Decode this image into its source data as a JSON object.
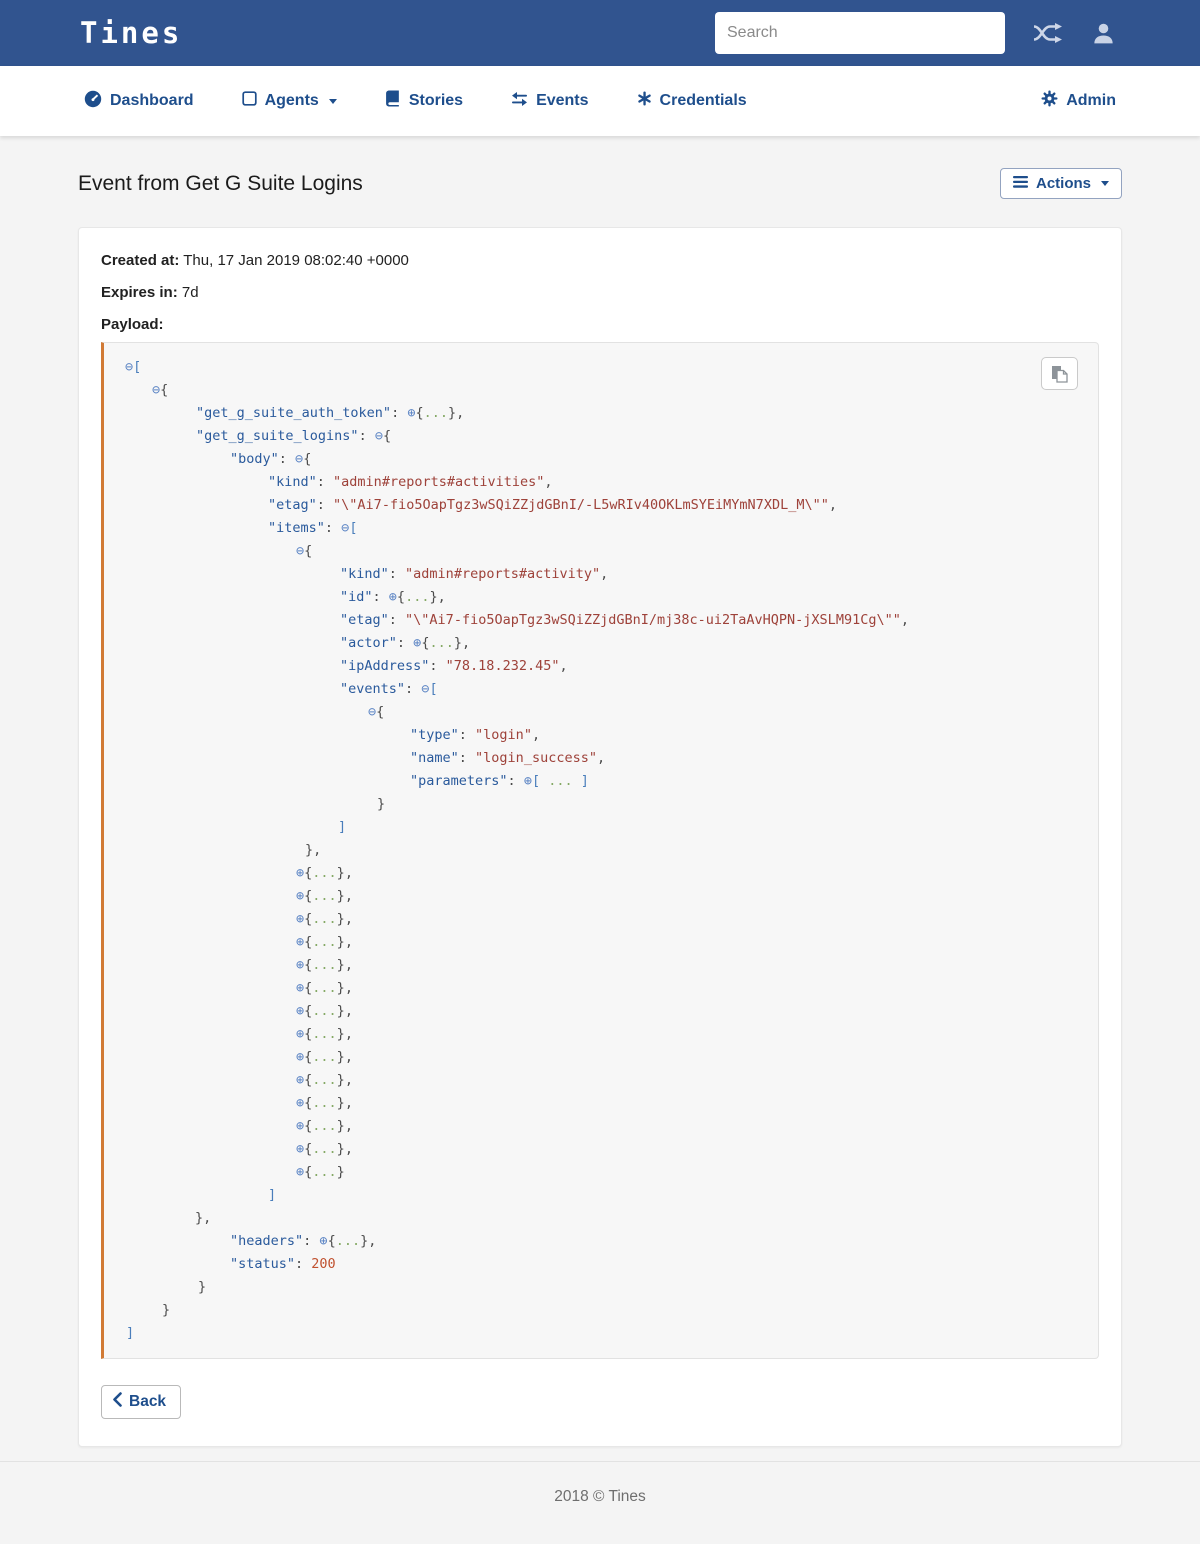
{
  "navbar": {
    "logo": "Tines",
    "search_placeholder": "Search",
    "shuffle_icon": "shuffle-icon",
    "user_icon": "user-icon"
  },
  "nav": {
    "items": [
      {
        "label": "Dashboard",
        "icon": "dashboard-gauge-icon"
      },
      {
        "label": "Agents",
        "icon": "agents-square-icon",
        "has_caret": true
      },
      {
        "label": "Stories",
        "icon": "stories-book-icon"
      },
      {
        "label": "Events",
        "icon": "events-exchange-icon"
      },
      {
        "label": "Credentials",
        "icon": "credentials-asterisk-icon"
      }
    ],
    "admin": {
      "label": "Admin",
      "icon": "admin-gear-icon"
    }
  },
  "page": {
    "title": "Event from Get G Suite Logins",
    "actions_label": "Actions"
  },
  "event": {
    "created_at_label": "Created at:",
    "created_at_value": "Thu, 17 Jan 2019 08:02:40 +0000",
    "expires_label": "Expires in:",
    "expires_value": "7d",
    "payload_label": "Payload:"
  },
  "buttons": {
    "back_label": "Back",
    "copy_icon": "copy-icon"
  },
  "footer": {
    "text": "2018 © Tines"
  },
  "colors": {
    "navbar_blue": "#31548f",
    "nav_link_blue": "#1e4e8c",
    "payload_accent_orange": "#d17a35",
    "json_key": "#2a5a9c",
    "json_string": "#9e423a",
    "json_number": "#c0512f",
    "json_disclosure": "#5b84c4",
    "json_ellipsis": "#85a965"
  },
  "payload": {
    "lines": [
      {
        "i": 0,
        "s": [
          [
            "d",
            "⊖"
          ],
          [
            "a",
            "["
          ]
        ]
      },
      {
        "i": 27,
        "s": [
          [
            "d",
            "⊖"
          ],
          [
            "o",
            "{"
          ]
        ]
      },
      {
        "i": 71,
        "s": [
          [
            "k",
            "\"get_g_suite_auth_token\""
          ],
          [
            "p",
            ": "
          ],
          [
            "d",
            "⊕"
          ],
          [
            "o",
            "{"
          ],
          [
            "e",
            "..."
          ],
          [
            "o",
            "}"
          ],
          [
            "p",
            ","
          ]
        ]
      },
      {
        "i": 71,
        "s": [
          [
            "k",
            "\"get_g_suite_logins\""
          ],
          [
            "p",
            ": "
          ],
          [
            "d",
            "⊖"
          ],
          [
            "o",
            "{"
          ]
        ]
      },
      {
        "i": 105,
        "s": [
          [
            "k",
            "\"body\""
          ],
          [
            "p",
            ": "
          ],
          [
            "d",
            "⊖"
          ],
          [
            "o",
            "{"
          ]
        ]
      },
      {
        "i": 143,
        "s": [
          [
            "k",
            "\"kind\""
          ],
          [
            "p",
            ": "
          ],
          [
            "s",
            "\"admin#reports#activities\""
          ],
          [
            "p",
            ","
          ]
        ]
      },
      {
        "i": 143,
        "s": [
          [
            "k",
            "\"etag\""
          ],
          [
            "p",
            ": "
          ],
          [
            "s",
            "\"\\\"Ai7-fio5OapTgz3wSQiZZjdGBnI/-L5wRIv40OKLmSYEiMYmN7XDL_M\\\"\""
          ],
          [
            "p",
            ","
          ]
        ]
      },
      {
        "i": 143,
        "s": [
          [
            "k",
            "\"items\""
          ],
          [
            "p",
            ": "
          ],
          [
            "d",
            "⊖"
          ],
          [
            "a",
            "["
          ]
        ]
      },
      {
        "i": 171,
        "s": [
          [
            "d",
            "⊖"
          ],
          [
            "o",
            "{"
          ]
        ]
      },
      {
        "i": 215,
        "s": [
          [
            "k",
            "\"kind\""
          ],
          [
            "p",
            ": "
          ],
          [
            "s",
            "\"admin#reports#activity\""
          ],
          [
            "p",
            ","
          ]
        ]
      },
      {
        "i": 215,
        "s": [
          [
            "k",
            "\"id\""
          ],
          [
            "p",
            ": "
          ],
          [
            "d",
            "⊕"
          ],
          [
            "o",
            "{"
          ],
          [
            "e",
            "..."
          ],
          [
            "o",
            "}"
          ],
          [
            "p",
            ","
          ]
        ]
      },
      {
        "i": 215,
        "s": [
          [
            "k",
            "\"etag\""
          ],
          [
            "p",
            ": "
          ],
          [
            "s",
            "\"\\\"Ai7-fio5OapTgz3wSQiZZjdGBnI/mj38c-ui2TaAvHQPN-jXSLM91Cg\\\"\""
          ],
          [
            "p",
            ","
          ]
        ]
      },
      {
        "i": 215,
        "s": [
          [
            "k",
            "\"actor\""
          ],
          [
            "p",
            ": "
          ],
          [
            "d",
            "⊕"
          ],
          [
            "o",
            "{"
          ],
          [
            "e",
            "..."
          ],
          [
            "o",
            "}"
          ],
          [
            "p",
            ","
          ]
        ]
      },
      {
        "i": 215,
        "s": [
          [
            "k",
            "\"ipAddress\""
          ],
          [
            "p",
            ": "
          ],
          [
            "s",
            "\"78.18.232.45\""
          ],
          [
            "p",
            ","
          ]
        ]
      },
      {
        "i": 215,
        "s": [
          [
            "k",
            "\"events\""
          ],
          [
            "p",
            ": "
          ],
          [
            "d",
            "⊖"
          ],
          [
            "a",
            "["
          ]
        ]
      },
      {
        "i": 243,
        "s": [
          [
            "d",
            "⊖"
          ],
          [
            "o",
            "{"
          ]
        ]
      },
      {
        "i": 285,
        "s": [
          [
            "k",
            "\"type\""
          ],
          [
            "p",
            ": "
          ],
          [
            "s",
            "\"login\""
          ],
          [
            "p",
            ","
          ]
        ]
      },
      {
        "i": 285,
        "s": [
          [
            "k",
            "\"name\""
          ],
          [
            "p",
            ": "
          ],
          [
            "s",
            "\"login_success\""
          ],
          [
            "p",
            ","
          ]
        ]
      },
      {
        "i": 285,
        "s": [
          [
            "k",
            "\"parameters\""
          ],
          [
            "p",
            ": "
          ],
          [
            "d",
            "⊕"
          ],
          [
            "a",
            "["
          ],
          [
            "e",
            " ... "
          ],
          [
            "a",
            "]"
          ]
        ]
      },
      {
        "i": 252,
        "s": [
          [
            "o",
            "}"
          ]
        ]
      },
      {
        "i": 213,
        "s": [
          [
            "a",
            "]"
          ]
        ]
      },
      {
        "i": 180,
        "s": [
          [
            "o",
            "}"
          ],
          [
            "p",
            ","
          ]
        ]
      },
      {
        "i": 171,
        "s": [
          [
            "d",
            "⊕"
          ],
          [
            "o",
            "{"
          ],
          [
            "e",
            "..."
          ],
          [
            "o",
            "}"
          ],
          [
            "p",
            ","
          ]
        ]
      },
      {
        "i": 171,
        "s": [
          [
            "d",
            "⊕"
          ],
          [
            "o",
            "{"
          ],
          [
            "e",
            "..."
          ],
          [
            "o",
            "}"
          ],
          [
            "p",
            ","
          ]
        ]
      },
      {
        "i": 171,
        "s": [
          [
            "d",
            "⊕"
          ],
          [
            "o",
            "{"
          ],
          [
            "e",
            "..."
          ],
          [
            "o",
            "}"
          ],
          [
            "p",
            ","
          ]
        ]
      },
      {
        "i": 171,
        "s": [
          [
            "d",
            "⊕"
          ],
          [
            "o",
            "{"
          ],
          [
            "e",
            "..."
          ],
          [
            "o",
            "}"
          ],
          [
            "p",
            ","
          ]
        ]
      },
      {
        "i": 171,
        "s": [
          [
            "d",
            "⊕"
          ],
          [
            "o",
            "{"
          ],
          [
            "e",
            "..."
          ],
          [
            "o",
            "}"
          ],
          [
            "p",
            ","
          ]
        ]
      },
      {
        "i": 171,
        "s": [
          [
            "d",
            "⊕"
          ],
          [
            "o",
            "{"
          ],
          [
            "e",
            "..."
          ],
          [
            "o",
            "}"
          ],
          [
            "p",
            ","
          ]
        ]
      },
      {
        "i": 171,
        "s": [
          [
            "d",
            "⊕"
          ],
          [
            "o",
            "{"
          ],
          [
            "e",
            "..."
          ],
          [
            "o",
            "}"
          ],
          [
            "p",
            ","
          ]
        ]
      },
      {
        "i": 171,
        "s": [
          [
            "d",
            "⊕"
          ],
          [
            "o",
            "{"
          ],
          [
            "e",
            "..."
          ],
          [
            "o",
            "}"
          ],
          [
            "p",
            ","
          ]
        ]
      },
      {
        "i": 171,
        "s": [
          [
            "d",
            "⊕"
          ],
          [
            "o",
            "{"
          ],
          [
            "e",
            "..."
          ],
          [
            "o",
            "}"
          ],
          [
            "p",
            ","
          ]
        ]
      },
      {
        "i": 171,
        "s": [
          [
            "d",
            "⊕"
          ],
          [
            "o",
            "{"
          ],
          [
            "e",
            "..."
          ],
          [
            "o",
            "}"
          ],
          [
            "p",
            ","
          ]
        ]
      },
      {
        "i": 171,
        "s": [
          [
            "d",
            "⊕"
          ],
          [
            "o",
            "{"
          ],
          [
            "e",
            "..."
          ],
          [
            "o",
            "}"
          ],
          [
            "p",
            ","
          ]
        ]
      },
      {
        "i": 171,
        "s": [
          [
            "d",
            "⊕"
          ],
          [
            "o",
            "{"
          ],
          [
            "e",
            "..."
          ],
          [
            "o",
            "}"
          ],
          [
            "p",
            ","
          ]
        ]
      },
      {
        "i": 171,
        "s": [
          [
            "d",
            "⊕"
          ],
          [
            "o",
            "{"
          ],
          [
            "e",
            "..."
          ],
          [
            "o",
            "}"
          ],
          [
            "p",
            ","
          ]
        ]
      },
      {
        "i": 171,
        "s": [
          [
            "d",
            "⊕"
          ],
          [
            "o",
            "{"
          ],
          [
            "e",
            "..."
          ],
          [
            "o",
            "}"
          ]
        ]
      },
      {
        "i": 143,
        "s": [
          [
            "a",
            "]"
          ]
        ]
      },
      {
        "i": 70,
        "s": [
          [
            "o",
            "}"
          ],
          [
            "p",
            ","
          ]
        ]
      },
      {
        "i": 105,
        "s": [
          [
            "k",
            "\"headers\""
          ],
          [
            "p",
            ": "
          ],
          [
            "d",
            "⊕"
          ],
          [
            "o",
            "{"
          ],
          [
            "e",
            "..."
          ],
          [
            "o",
            "}"
          ],
          [
            "p",
            ","
          ]
        ]
      },
      {
        "i": 105,
        "s": [
          [
            "k",
            "\"status\""
          ],
          [
            "p",
            ": "
          ],
          [
            "n",
            "200"
          ]
        ]
      },
      {
        "i": 73,
        "s": [
          [
            "o",
            "}"
          ]
        ]
      },
      {
        "i": 37,
        "s": [
          [
            "o",
            "}"
          ]
        ]
      },
      {
        "i": 1,
        "s": [
          [
            "a",
            "]"
          ]
        ]
      }
    ]
  }
}
